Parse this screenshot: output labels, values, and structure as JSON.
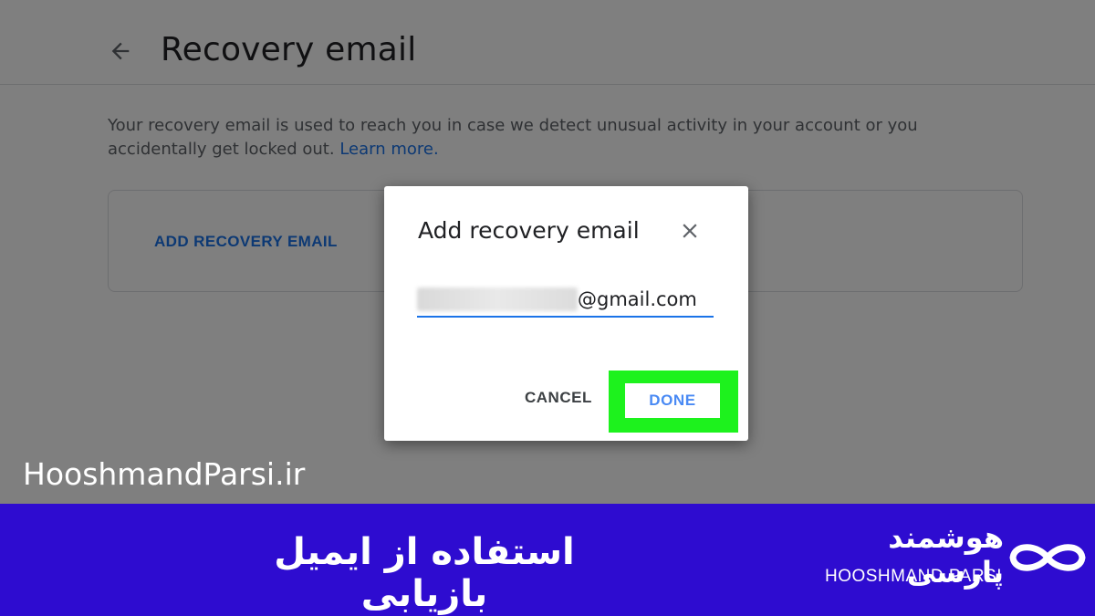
{
  "header": {
    "title": "Recovery email",
    "back_icon": "arrow-left-icon"
  },
  "description": {
    "text": "Your recovery email is used to reach you in case we detect unusual activity in your account or you accidentally get locked out.",
    "link": "Learn more."
  },
  "card": {
    "add_label": "ADD RECOVERY EMAIL"
  },
  "dialog": {
    "title": "Add recovery email",
    "close_icon": "close-icon",
    "email_suffix": "@gmail.com",
    "cancel_label": "CANCEL",
    "done_label": "DONE"
  },
  "watermark": "HooshmandParsi.ir",
  "banner": {
    "caption": "استفاده از ایمیل بازیابی",
    "brand_fa": "هوشمند پارسی",
    "brand_en": "HOOSHMAND PARSI"
  },
  "colors": {
    "accent": "#1a73e8",
    "highlight": "#1df21d",
    "banner": "#2e0cd0"
  }
}
